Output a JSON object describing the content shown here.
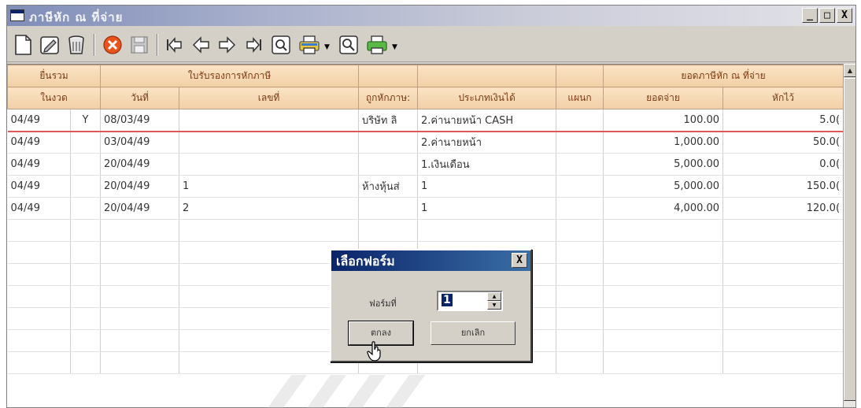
{
  "window": {
    "title": "ภาษีหัก ณ ที่จ่าย",
    "controls": {
      "minimize": "_",
      "maximize": "□",
      "close": "X"
    }
  },
  "toolbar": {
    "buttons": [
      {
        "name": "new-document-icon"
      },
      {
        "name": "edit-icon"
      },
      {
        "name": "delete-bin-icon"
      },
      {
        "name": "cancel-icon"
      },
      {
        "name": "save-icon"
      },
      {
        "name": "first-record-icon"
      },
      {
        "name": "previous-record-icon"
      },
      {
        "name": "next-record-icon"
      },
      {
        "name": "last-record-icon"
      },
      {
        "name": "search-icon"
      },
      {
        "name": "print-icon",
        "dropdown": true
      },
      {
        "name": "print-preview-icon"
      },
      {
        "name": "print-form-icon",
        "dropdown": true
      }
    ]
  },
  "grid": {
    "group_headers": {
      "filing": "ยื่นรวม",
      "certificate": "ใบรับรองการหักภาษี",
      "tax_group": "ยอดภาษีหัก ณ ที่จ่าย"
    },
    "columns": {
      "period": "ในงวด",
      "date": "วันที่",
      "number": "เลขที่",
      "payee": "ถูกหักภาษ:",
      "income_type": "ประเภทเงินได้",
      "department": "แผนก",
      "amount_paid": "ยอดจ่าย",
      "withheld": "หักไว้"
    },
    "rows": [
      {
        "period": "04/49",
        "flag": "Y",
        "date": "08/03/49",
        "number": "",
        "payee": "บริษัท ลิ",
        "income_type": "2.ค่านายหน้า  CASH",
        "department": "",
        "amount_paid": "100.00",
        "withheld": "5.0("
      },
      {
        "period": "04/49",
        "flag": "",
        "date": "03/04/49",
        "number": "",
        "payee": "",
        "income_type": "2.ค่านายหน้า",
        "department": "",
        "amount_paid": "1,000.00",
        "withheld": "50.0("
      },
      {
        "period": "04/49",
        "flag": "",
        "date": "20/04/49",
        "number": "",
        "payee": "",
        "income_type": "1.เงินเดือน",
        "department": "",
        "amount_paid": "5,000.00",
        "withheld": "0.0("
      },
      {
        "period": "04/49",
        "flag": "",
        "date": "20/04/49",
        "number": "1",
        "payee": "ห้างหุ้นส่",
        "income_type": "1",
        "department": "",
        "amount_paid": "5,000.00",
        "withheld": "150.0("
      },
      {
        "period": "04/49",
        "flag": "",
        "date": "20/04/49",
        "number": "2",
        "payee": "",
        "income_type": "1",
        "department": "",
        "amount_paid": "4,000.00",
        "withheld": "120.0("
      }
    ],
    "empty_rows": 7
  },
  "dialog": {
    "title": "เลือกฟอร์ม",
    "close": "X",
    "form_label": "ฟอร์มที่",
    "form_value": "1",
    "ok_label": "ตกลง",
    "cancel_label": "ยกเลิก"
  },
  "colors": {
    "header_bg": "#f0cfa6",
    "header_text": "#7a3b14",
    "current_row_line": "#e05a5a",
    "dialog_title_bg": "#0a246a",
    "window_bg": "#d4d0c8"
  }
}
